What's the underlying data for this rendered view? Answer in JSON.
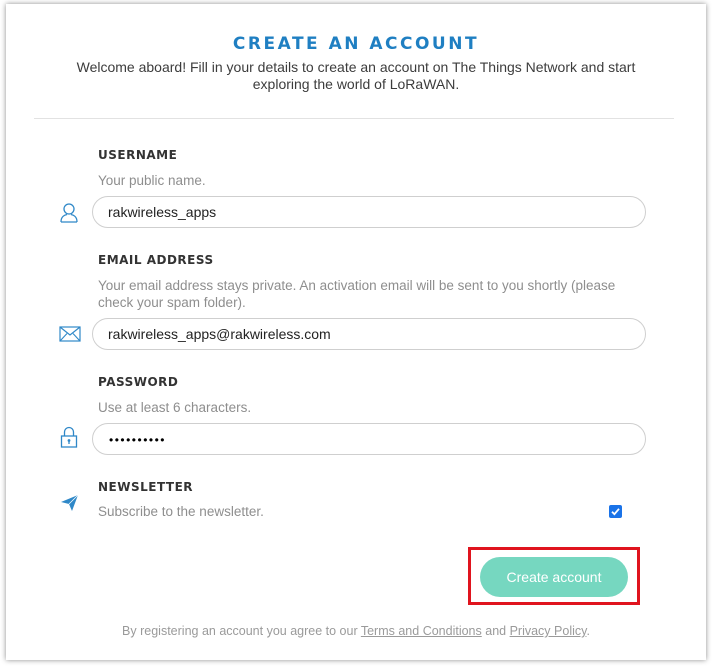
{
  "header": {
    "title": "CREATE AN ACCOUNT",
    "subtitle_line1": "Welcome aboard! Fill in your details to create an account on The Things Network and start",
    "subtitle_line2": "exploring the world of LoRaWAN."
  },
  "form": {
    "username": {
      "label": "USERNAME",
      "hint": "Your public name.",
      "value": "rakwireless_apps",
      "icon": "user-icon"
    },
    "email": {
      "label": "EMAIL ADDRESS",
      "hint_line1": "Your email address stays private. An activation email will be sent to you shortly (please",
      "hint_line2": "check your spam folder).",
      "value": "rakwireless_apps@rakwireless.com",
      "icon": "envelope-icon"
    },
    "password": {
      "label": "PASSWORD",
      "hint": "Use at least 6 characters.",
      "masked_value": "••••••••••",
      "icon": "lock-icon"
    },
    "newsletter": {
      "label": "NEWSLETTER",
      "hint": "Subscribe to the newsletter.",
      "checked": true,
      "icon": "paper-plane-icon"
    }
  },
  "actions": {
    "submit_label": "Create account"
  },
  "footer": {
    "prefix": "By registering an account you agree to our ",
    "terms_link": "Terms and Conditions",
    "middle": " and ",
    "privacy_link": "Privacy Policy",
    "suffix": "."
  },
  "colors": {
    "title": "#1f7fc2",
    "button": "#76d7c0",
    "highlight": "#e0141e",
    "icon": "#2f88c8"
  }
}
